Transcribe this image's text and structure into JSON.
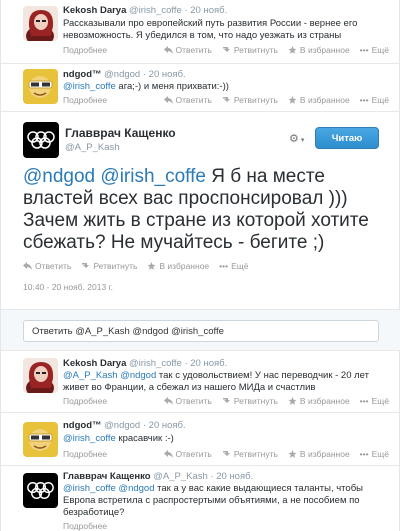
{
  "tweets": [
    {
      "name": "Kekosh Darya",
      "handle": "@irish_coffe",
      "time": "20 нояб.",
      "text": "Рассказывали про европейский путь развития России - вернее его невозможность. Я убедился в том, что надо уезжать из страны",
      "more": "Подробнее"
    },
    {
      "name": "ndgod™",
      "handle": "@ndgod",
      "time": "20 нояб.",
      "mention": "@irish_coffe",
      "text": " ага;-) и меня прихвати:-))",
      "more": "Подробнее"
    }
  ],
  "actions": {
    "reply": "Ответить",
    "retweet": "Ретвитнуть",
    "favorite": "В избранное",
    "more": "Ещё"
  },
  "main": {
    "name": "Главврач Кащенко",
    "handle": "@A_P_Kash",
    "follow_label": "Читаю",
    "mention1": "@ndgod",
    "mention2": "@irish_coffe",
    "text": " Я б на месте властей всех вас проспонсировал ))) Зачем жить в стране из которой хотите сбежать? Не мучайтесь - бегите ;)",
    "timestamp": "10:40 - 20 нояб. 2013 г."
  },
  "reply_box": {
    "value": "Ответить @A_P_Kash @ndgod @irish_coffe"
  },
  "replies": [
    {
      "name": "Kekosh Darya",
      "handle": "@irish_coffe",
      "time": "20 нояб.",
      "mention1": "@A_P_Kash",
      "mention2": "@ndgod",
      "text": " так с удовольствием! У нас переводчик - 20 лет живет во Франции, а сбежал из нашего МИДа и счастлив",
      "more": "Подробнее"
    },
    {
      "name": "ndgod™",
      "handle": "@ndgod",
      "time": "20 нояб.",
      "mention1": "@irish_coffe",
      "text": " красавчик :-)",
      "more": "Подробнее"
    },
    {
      "name": "Главврач Кащенко",
      "handle": "@A_P_Kash",
      "time": "20 нояб.",
      "mention1": "@irish_coffe",
      "mention2": "@ndgod",
      "text": " так а у вас какие выдающиеся таланты, чтобы Европа встретила с распростертыми объятиями, а не пособием по безработице?",
      "more": "Подробнее"
    }
  ],
  "colors": {
    "link": "#2b7bb9",
    "follow_button": "#2e8dcd"
  }
}
